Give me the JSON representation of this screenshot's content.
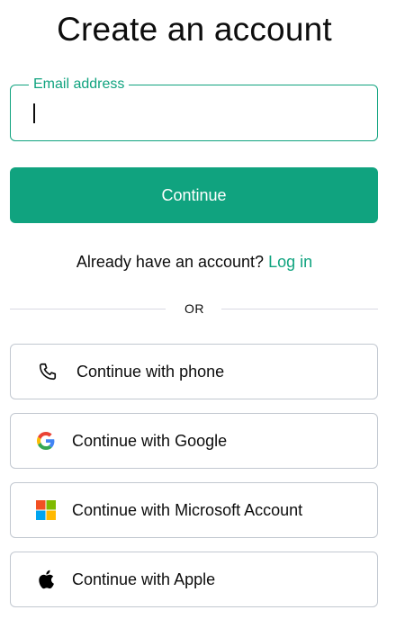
{
  "title": "Create an account",
  "email": {
    "label": "Email address",
    "value": ""
  },
  "continue_label": "Continue",
  "login_prompt": {
    "text": "Already have an account?",
    "link": "Log in"
  },
  "divider_text": "OR",
  "social_buttons": [
    {
      "label": "Continue with phone",
      "icon": "phone-icon"
    },
    {
      "label": "Continue with Google",
      "icon": "google-icon"
    },
    {
      "label": "Continue with Microsoft Account",
      "icon": "microsoft-icon"
    },
    {
      "label": "Continue with Apple",
      "icon": "apple-icon"
    }
  ],
  "colors": {
    "accent": "#10a37f",
    "border": "#c2c8d0",
    "divider": "#d9d9e3",
    "text": "#0d0d0d"
  }
}
